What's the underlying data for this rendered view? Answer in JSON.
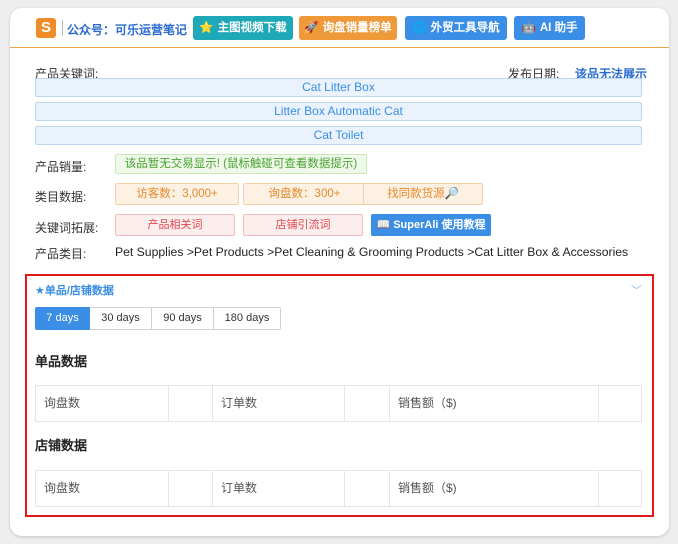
{
  "toolbar": {
    "logo_letter": "S",
    "public_account": "公众号：可乐运营笔记",
    "buttons": [
      {
        "icon": "⭐",
        "label": "主图视频下载",
        "color": "#1fa8b8"
      },
      {
        "icon": "🚀",
        "label": "询盘销量榜单",
        "color": "#ef9a3a"
      },
      {
        "icon": "🌐",
        "label": "外贸工具导航",
        "color": "#3a8ee6"
      },
      {
        "icon": "🤖",
        "label": "AI 助手",
        "color": "#3a8ee6"
      }
    ]
  },
  "product": {
    "keywords_label": "产品关键词:",
    "release_date_label": "发布日期:",
    "release_date_value": "该品无法展示",
    "keywords": [
      "Cat Litter Box",
      "Litter Box Automatic Cat",
      "Cat Toilet"
    ],
    "sales_label": "产品销量:",
    "sales_value": "该品暂无交易显示! (鼠标触碰可查看数据提示)",
    "category_data_label": "类目数据:",
    "visitors": "访客数：3,000+",
    "inquiries": "询盘数：300+",
    "find_source": "找同款货源🔎",
    "keyword_expand_label": "关键词拓展:",
    "related_keywords": "产品相关词",
    "store_traffic_keywords": "店铺引流词",
    "tutorial_button": "📖 SuperAli 使用教程",
    "category_label": "产品类目:",
    "category_path": "Pet Supplies >Pet Products >Pet Cleaning & Grooming Products >Cat Litter Box & Accessories"
  },
  "stats_panel": {
    "title": "★单品/店铺数据",
    "collapse_icon": "chevron-down",
    "tabs": [
      "7 days",
      "30 days",
      "90 days",
      "180 days"
    ],
    "active_tab": "7 days",
    "single_title": "单品数据",
    "store_title": "店铺数据",
    "columns": [
      "询盘数",
      "订单数",
      "销售额（$)"
    ]
  },
  "colors": {
    "accent": "#3a8ee6",
    "highlight": "#e01a1a",
    "orange": "#ef9a3a",
    "teal": "#1fa8b8"
  }
}
